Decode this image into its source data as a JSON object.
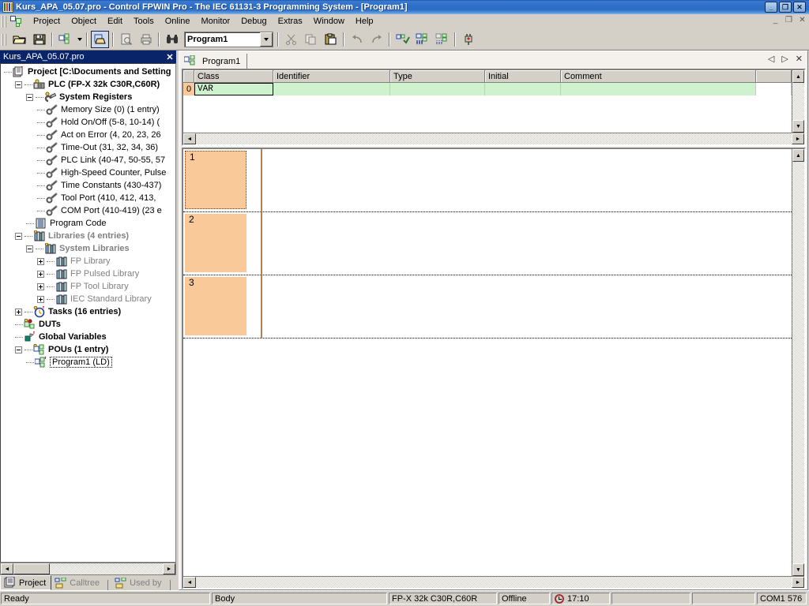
{
  "window": {
    "title": "Kurs_APA_05.07.pro - Control FPWIN Pro - The IEC 61131-3 Programming System - [Program1]",
    "app_icon": "fpwin-icon",
    "minimize": "_",
    "maximize": "❐",
    "close": "✕"
  },
  "menubar": {
    "icon": "project-nodes-icon",
    "items": [
      {
        "label": "Project"
      },
      {
        "label": "Object"
      },
      {
        "label": "Edit"
      },
      {
        "label": "Tools"
      },
      {
        "label": "Online"
      },
      {
        "label": "Monitor"
      },
      {
        "label": "Debug"
      },
      {
        "label": "Extras"
      },
      {
        "label": "Window"
      },
      {
        "label": "Help"
      }
    ],
    "mdi_minimize": "_",
    "mdi_restore": "❐",
    "mdi_close": "✕"
  },
  "toolbar": {
    "open_label": "Open",
    "save_label": "Save",
    "download_label": "Download Program Code and PLC Configuration",
    "dropdown_label": "Download options",
    "open_pou_label": "Open POU",
    "print_preview_label": "Print Preview",
    "print_label": "Print",
    "find_label": "Find",
    "pou_combo_value": "Program1",
    "pou_combo_arrow": "▼",
    "cut_label": "Cut",
    "copy_label": "Copy",
    "paste_label": "Paste",
    "undo_label": "Undo",
    "redo_label": "Redo",
    "compile_label": "Compile",
    "download_pc_to_plc_label": "Download to PLC",
    "upload_plc_to_pc_label": "Upload from PLC",
    "online_label": "Online/Offline"
  },
  "project_pane": {
    "title": "Kurs_APA_05.07.pro",
    "close_glyph": "✕",
    "tree": [
      {
        "depth": 0,
        "expander": "none",
        "icon": "project-icon",
        "label": "Project [C:\\Documents and Setting",
        "style": "bold"
      },
      {
        "depth": 1,
        "expander": "minus",
        "icon": "plc-icon",
        "label": "PLC (FP-X 32k C30R,C60R)",
        "style": "bold"
      },
      {
        "depth": 2,
        "expander": "minus",
        "icon": "system-registers-icon",
        "label": "System Registers",
        "style": "bold"
      },
      {
        "depth": 3,
        "expander": "none",
        "icon": "wrench-icon",
        "label": "Memory Size (0) (1 entry)",
        "style": "normal"
      },
      {
        "depth": 3,
        "expander": "none",
        "icon": "wrench-icon",
        "label": "Hold On/Off (5-8, 10-14) (",
        "style": "normal"
      },
      {
        "depth": 3,
        "expander": "none",
        "icon": "wrench-icon",
        "label": "Act on Error (4, 20, 23, 26",
        "style": "normal"
      },
      {
        "depth": 3,
        "expander": "none",
        "icon": "wrench-icon",
        "label": "Time-Out (31, 32, 34, 36)",
        "style": "normal"
      },
      {
        "depth": 3,
        "expander": "none",
        "icon": "wrench-icon",
        "label": "PLC Link (40-47, 50-55, 57",
        "style": "normal"
      },
      {
        "depth": 3,
        "expander": "none",
        "icon": "wrench-icon",
        "label": "High-Speed Counter, Pulse",
        "style": "normal"
      },
      {
        "depth": 3,
        "expander": "none",
        "icon": "wrench-icon",
        "label": "Time Constants (430-437)",
        "style": "normal"
      },
      {
        "depth": 3,
        "expander": "none",
        "icon": "wrench-icon",
        "label": "Tool Port (410, 412, 413,",
        "style": "normal"
      },
      {
        "depth": 3,
        "expander": "none",
        "icon": "wrench-icon",
        "label": "COM Port (410-419) (23 e",
        "style": "normal"
      },
      {
        "depth": 2,
        "expander": "none",
        "icon": "program-code-icon",
        "label": "Program Code",
        "style": "normal"
      },
      {
        "depth": 1,
        "expander": "minus",
        "icon": "libraries-icon",
        "label": "Libraries (4 entries)",
        "style": "bold-gray"
      },
      {
        "depth": 2,
        "expander": "minus",
        "icon": "libraries-icon",
        "label": "System Libraries",
        "style": "bold-gray"
      },
      {
        "depth": 3,
        "expander": "plus",
        "icon": "library-icon",
        "label": "FP Library",
        "style": "gray"
      },
      {
        "depth": 3,
        "expander": "plus",
        "icon": "library-icon",
        "label": "FP Pulsed Library",
        "style": "gray"
      },
      {
        "depth": 3,
        "expander": "plus",
        "icon": "library-icon",
        "label": "FP Tool Library",
        "style": "gray"
      },
      {
        "depth": 3,
        "expander": "plus",
        "icon": "library-icon",
        "label": "IEC Standard Library",
        "style": "gray"
      },
      {
        "depth": 1,
        "expander": "plus",
        "icon": "tasks-clock-icon",
        "label": "Tasks (16 entries)",
        "style": "bold"
      },
      {
        "depth": 1,
        "expander": "none",
        "icon": "duts-icon",
        "label": "DUTs",
        "style": "bold"
      },
      {
        "depth": 1,
        "expander": "none",
        "icon": "global-variables-icon",
        "label": "Global Variables",
        "style": "bold"
      },
      {
        "depth": 1,
        "expander": "minus",
        "icon": "pous-icon",
        "label": "POUs (1 entry)",
        "style": "bold"
      },
      {
        "depth": 2,
        "expander": "none",
        "icon": "pou-ld-icon",
        "label": "Program1 (LD)",
        "style": "selected"
      }
    ],
    "tabs": [
      {
        "label": "Project",
        "icon": "project-tab-icon",
        "active": true
      },
      {
        "label": "Calltree",
        "icon": "calltree-icon",
        "active": false
      },
      {
        "label": "Used by",
        "icon": "usedby-icon",
        "active": false
      }
    ]
  },
  "editor": {
    "tab": {
      "label": "Program1",
      "icon": "pou-ld-icon"
    },
    "nav_prev": "◁",
    "nav_next": "▷",
    "nav_close": "✕",
    "variable_table": {
      "columns": [
        "",
        "Class",
        "Identifier",
        "Type",
        "Initial",
        "Comment",
        ""
      ],
      "rows": [
        {
          "num": "0",
          "class": "VAR",
          "identifier": "",
          "type": "",
          "initial": "",
          "comment": "",
          "extra": ""
        }
      ]
    },
    "ladder": {
      "rungs": [
        {
          "number": "1",
          "selected": true
        },
        {
          "number": "2",
          "selected": false
        },
        {
          "number": "3",
          "selected": false
        }
      ]
    },
    "scroll_up": "▲",
    "scroll_down": "▼",
    "scroll_left": "◄",
    "scroll_right": "►"
  },
  "statusbar": {
    "message": "Ready",
    "body": "Body",
    "plc_type": "FP-X 32k C30R,C60R",
    "connection": "Offline",
    "clock_icon": "clock-icon",
    "time": "17:10",
    "field_a": "",
    "field_b": "",
    "port": "COM1 576"
  },
  "colors": {
    "title_blue": "#2f6ec6",
    "face": "#d4d0c8",
    "rung_orange": "#fac99a",
    "cell_green": "#cdf2cd",
    "shadow": "#808080"
  }
}
